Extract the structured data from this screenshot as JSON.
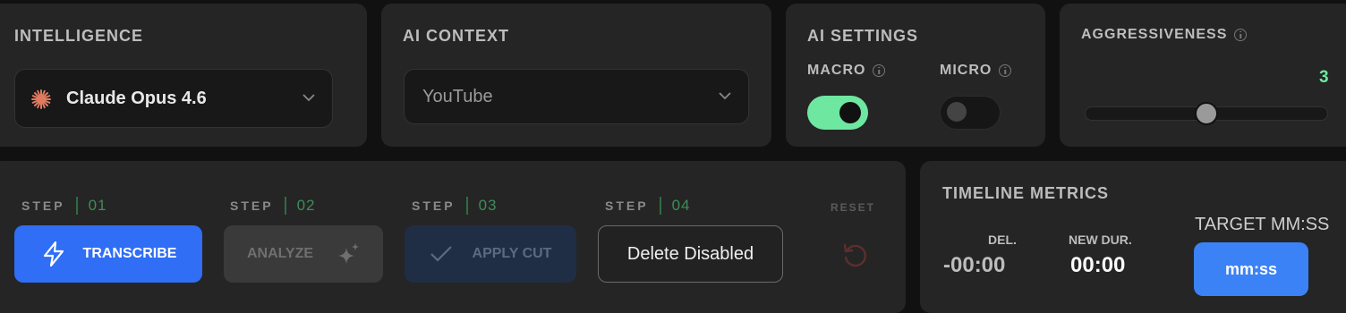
{
  "intelligence": {
    "title": "INTELLIGENCE",
    "model": "Claude Opus 4.6",
    "model_icon": "claude-burst-icon"
  },
  "ai_context": {
    "title": "AI CONTEXT",
    "value": "YouTube"
  },
  "ai_settings": {
    "title": "AI SETTINGS",
    "macro_label": "MACRO",
    "macro_on": true,
    "micro_label": "MICRO",
    "micro_on": false
  },
  "aggressiveness": {
    "title": "AGGRESSIVENESS",
    "value": "3",
    "level_fraction": 0.5
  },
  "steps": {
    "step_word": "STEP",
    "items": [
      {
        "num": "01",
        "label": "TRANSCRIBE"
      },
      {
        "num": "02",
        "label": "ANALYZE"
      },
      {
        "num": "03",
        "label": "APPLY CUT"
      },
      {
        "num": "04",
        "label": "Delete Disabled"
      }
    ],
    "reset_label": "RESET"
  },
  "timeline": {
    "title": "TIMELINE METRICS",
    "del_label": "DEL.",
    "del_value": "-00:00",
    "new_dur_label": "NEW DUR.",
    "new_dur_value": "00:00",
    "target_label": "TARGET MM:SS",
    "target_placeholder": "mm:ss"
  },
  "colors": {
    "accent_green": "#6ee7a0",
    "primary_blue": "#2f6ef5",
    "target_blue": "#3b82f6",
    "claude_orange": "#e07a5f"
  }
}
